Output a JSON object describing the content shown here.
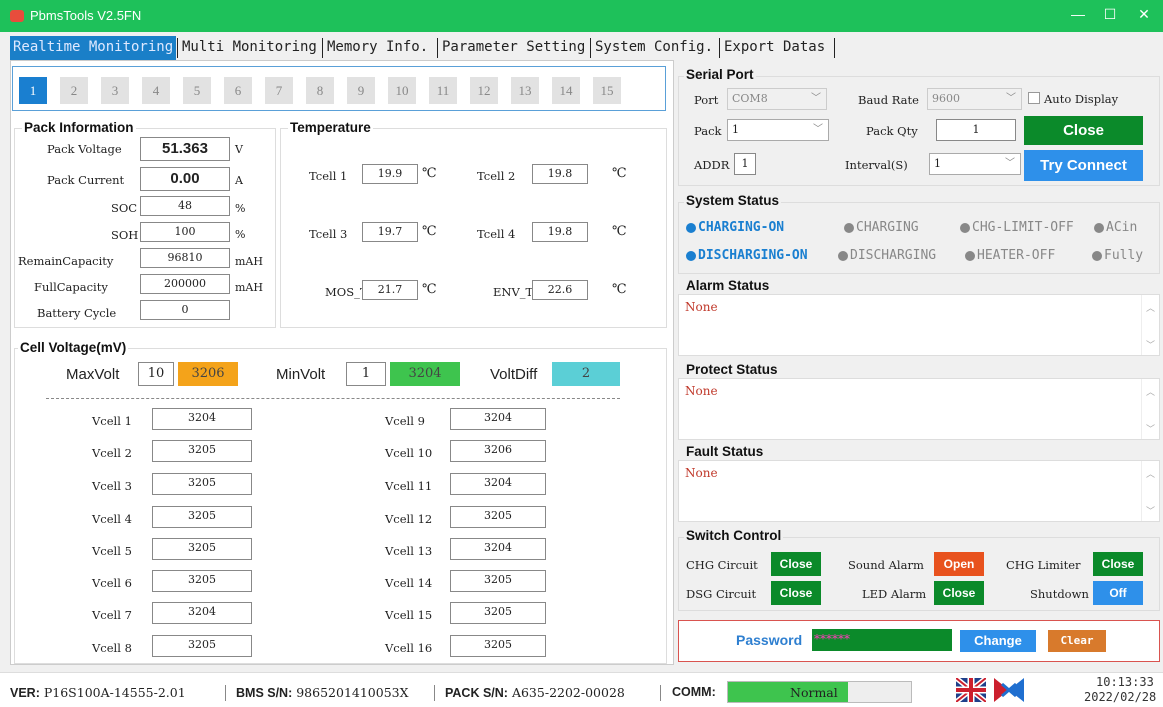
{
  "app": {
    "title": "PbmsTools V2.5FN",
    "minimize": "—",
    "maximize": "☐",
    "close": "✕"
  },
  "tabs": [
    "Realtime Monitoring",
    "Multi Monitoring",
    "Memory Info.",
    "Parameter Setting",
    "System Config.",
    "Export Datas"
  ],
  "packs": [
    "1",
    "2",
    "3",
    "4",
    "5",
    "6",
    "7",
    "8",
    "9",
    "10",
    "11",
    "12",
    "13",
    "14",
    "15"
  ],
  "pack_info": {
    "title": "Pack Information",
    "voltage": {
      "label": "Pack Voltage",
      "value": "51.363",
      "unit": "V"
    },
    "current": {
      "label": "Pack Current",
      "value": "0.00",
      "unit": "A"
    },
    "soc": {
      "label": "SOC",
      "value": "48",
      "unit": "%"
    },
    "soh": {
      "label": "SOH",
      "value": "100",
      "unit": "%"
    },
    "remain": {
      "label": "RemainCapacity",
      "value": "96810",
      "unit": "mAH"
    },
    "full": {
      "label": "FullCapacity",
      "value": "200000",
      "unit": "mAH"
    },
    "cycle": {
      "label": "Battery Cycle",
      "value": "0"
    }
  },
  "temperature": {
    "title": "Temperature",
    "unit": "℃",
    "tcell1": {
      "label": "Tcell 1",
      "value": "19.9"
    },
    "tcell2": {
      "label": "Tcell 2",
      "value": "19.8"
    },
    "tcell3": {
      "label": "Tcell 3",
      "value": "19.7"
    },
    "tcell4": {
      "label": "Tcell 4",
      "value": "19.8"
    },
    "mos": {
      "label": "MOS_T",
      "value": "21.7"
    },
    "env": {
      "label": "ENV_T",
      "value": "22.6"
    }
  },
  "cell_voltage": {
    "title": "Cell Voltage(mV)",
    "max_label": "MaxVolt",
    "max_idx": "10",
    "max_val": "3206",
    "min_label": "MinVolt",
    "min_idx": "1",
    "min_val": "3204",
    "diff_label": "VoltDiff",
    "diff_val": "2",
    "cells": [
      {
        "label": "Vcell 1",
        "value": "3204"
      },
      {
        "label": "Vcell 2",
        "value": "3205"
      },
      {
        "label": "Vcell 3",
        "value": "3205"
      },
      {
        "label": "Vcell 4",
        "value": "3205"
      },
      {
        "label": "Vcell 5",
        "value": "3205"
      },
      {
        "label": "Vcell 6",
        "value": "3205"
      },
      {
        "label": "Vcell 7",
        "value": "3204"
      },
      {
        "label": "Vcell 8",
        "value": "3205"
      },
      {
        "label": "Vcell 9",
        "value": "3204"
      },
      {
        "label": "Vcell 10",
        "value": "3206"
      },
      {
        "label": "Vcell 11",
        "value": "3204"
      },
      {
        "label": "Vcell 12",
        "value": "3205"
      },
      {
        "label": "Vcell 13",
        "value": "3204"
      },
      {
        "label": "Vcell 14",
        "value": "3205"
      },
      {
        "label": "Vcell 15",
        "value": "3205"
      },
      {
        "label": "Vcell 16",
        "value": "3205"
      }
    ]
  },
  "serial": {
    "title": "Serial Port",
    "port_label": "Port",
    "port_value": "COM8",
    "baud_label": "Baud Rate",
    "baud_value": "9600",
    "auto_display": "Auto Display",
    "pack_label": "Pack",
    "pack_value": "1",
    "qty_label": "Pack Qty",
    "qty_value": "1",
    "close_btn": "Close",
    "addr_label": "ADDR",
    "addr_value": "1",
    "interval_label": "Interval(S)",
    "interval_value": "1",
    "connect_btn": "Try Connect"
  },
  "system_status": {
    "title": "System Status",
    "row1": [
      "CHARGING-ON",
      "CHARGING",
      "CHG-LIMIT-OFF",
      "ACin"
    ],
    "row2": [
      "DISCHARGING-ON",
      "DISCHARGING",
      "HEATER-OFF",
      "Fully"
    ]
  },
  "alarm": {
    "title": "Alarm Status",
    "text": "None"
  },
  "protect": {
    "title": "Protect Status",
    "text": "None"
  },
  "fault": {
    "title": "Fault Status",
    "text": "None"
  },
  "switch": {
    "title": "Switch Control",
    "chg_label": "CHG Circuit",
    "chg_btn": "Close",
    "sound_label": "Sound Alarm",
    "sound_btn": "Open",
    "limiter_label": "CHG Limiter",
    "limiter_btn": "Close",
    "dsg_label": "DSG Circuit",
    "dsg_btn": "Close",
    "led_label": "LED Alarm",
    "led_btn": "Close",
    "shutdown_label": "Shutdown",
    "shutdown_btn": "Off"
  },
  "password": {
    "label": "Password",
    "value": "******",
    "change_btn": "Change",
    "clear_btn": "Clear"
  },
  "statusbar": {
    "ver_label": "VER:",
    "ver": "P16S100A-14555-2.01",
    "bms_label": "BMS S/N:",
    "bms": "9865201410053X",
    "pack_label": "PACK S/N:",
    "pack": "A635-2202-00028",
    "comm_label": "COMM:",
    "comm": "Normal",
    "time": "10:13:33",
    "date": "2022/02/28"
  },
  "colors": {
    "title_green": "#1ec15a",
    "tab_blue": "#1a7fc8",
    "btn_green": "#0b8a2a",
    "btn_blue": "#2e90ea",
    "btn_orange": "#e8521e",
    "max_orange": "#f4a31a",
    "min_green": "#3ec44e",
    "diff_cyan": "#5bcfd6",
    "status_blue": "#1a7fd0",
    "status_gray": "#888888"
  }
}
